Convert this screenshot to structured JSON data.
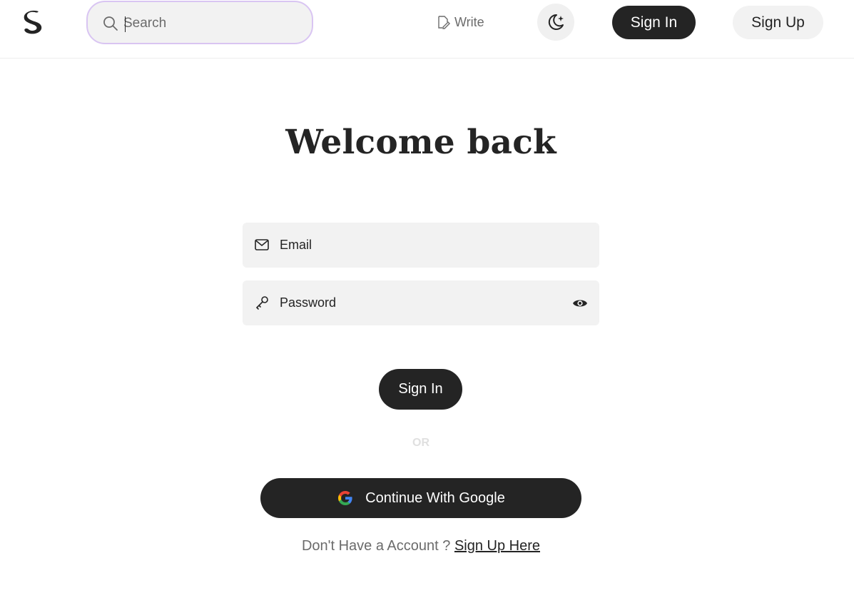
{
  "header": {
    "logo_icon": "snake-logo",
    "search": {
      "placeholder": "Search",
      "value": ""
    },
    "write_label": "Write",
    "theme_icon": "moon-stars-icon",
    "signin_label": "Sign In",
    "signup_label": "Sign Up"
  },
  "form": {
    "title": "Welcome back",
    "email_placeholder": "Email",
    "password_placeholder": "Password",
    "signin_label": "Sign In",
    "or_label": "OR",
    "google_label": "Continue With Google",
    "footer_text": "Don't Have a Account ?",
    "footer_link": "Sign Up Here"
  },
  "colors": {
    "primary": "#242424",
    "field_bg": "#f2f2f2",
    "search_border": "#d9c5f2",
    "muted_text": "#6b6b6b"
  }
}
